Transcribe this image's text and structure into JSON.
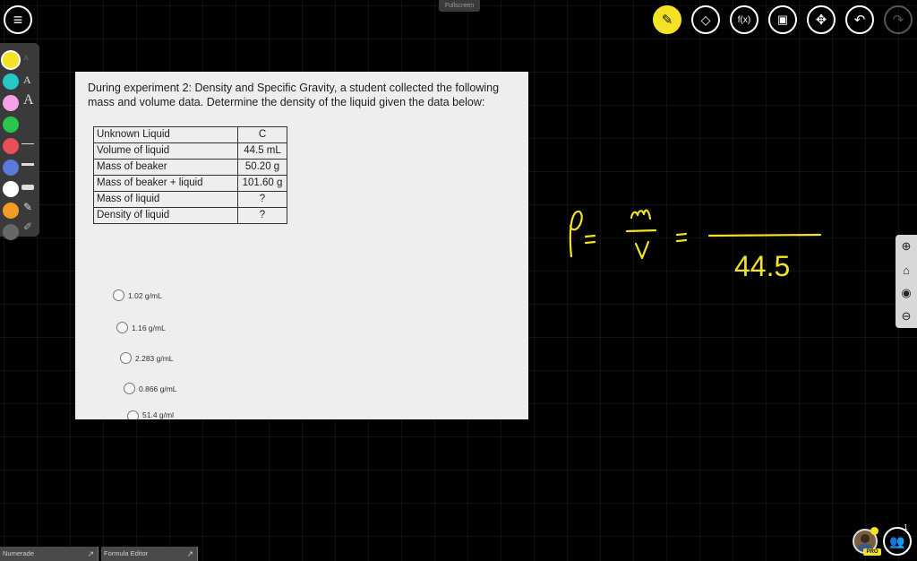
{
  "top": {
    "fullscreen_label": "Fullscreen",
    "tools": [
      {
        "name": "pencil-tool",
        "icon": "pencil-icon",
        "glyph": "✎",
        "state": "active"
      },
      {
        "name": "eraser-tool",
        "icon": "eraser-icon",
        "glyph": "◇",
        "state": "normal"
      },
      {
        "name": "function-tool",
        "icon": "function-icon",
        "glyph": "f(x)",
        "state": "normal"
      },
      {
        "name": "equation-tool",
        "icon": "equation-editor-icon",
        "glyph": "▣",
        "state": "normal"
      },
      {
        "name": "move-tool",
        "icon": "move-icon",
        "glyph": "✥",
        "state": "normal"
      },
      {
        "name": "undo-tool",
        "icon": "undo-icon",
        "glyph": "↶",
        "state": "normal"
      },
      {
        "name": "redo-tool",
        "icon": "redo-icon",
        "glyph": "↷",
        "state": "disabled"
      }
    ]
  },
  "palette": {
    "colors": [
      "#f4e324",
      "#26c7c9",
      "#f4a2e8",
      "#28c74b",
      "#e5505a",
      "#5a7bd9",
      "#ffffff",
      "#f29c24"
    ],
    "text_sizes": [
      "A",
      "A",
      "A"
    ],
    "accent": "#f4e324"
  },
  "document": {
    "title": "During experiment 2: Density and Specific Gravity, a student collected the following mass and volume data. Determine the density of the liquid given the data below:",
    "table": [
      {
        "label": "Unknown Liquid",
        "value": "C"
      },
      {
        "label": "Volume of liquid",
        "value": "44.5 mL"
      },
      {
        "label": "Mass of beaker",
        "value": "50.20 g"
      },
      {
        "label": "Mass of beaker  + liquid",
        "value": "101.60 g"
      },
      {
        "label": "Mass of liquid",
        "value": "?"
      },
      {
        "label": "Density of liquid",
        "value": "?"
      }
    ],
    "options": [
      "1.02 g/mL",
      "1.16 g/mL",
      "2.283 g/mL",
      "0.866 g/mL",
      "51.4 g/ml"
    ]
  },
  "handwriting": {
    "rho": "ρ",
    "eq1": "=",
    "numerator": "m",
    "denominator": "V",
    "eq2": "=",
    "value": "44.5",
    "ink_color": "#f4e324"
  },
  "sidenav": {
    "icons": [
      "zoom-in-icon",
      "home-icon",
      "target-icon",
      "zoom-out-icon"
    ]
  },
  "bottom": {
    "tabs": [
      "Numerade",
      "Formula Editor"
    ],
    "pro_label": "PRO",
    "users_count": "1"
  }
}
